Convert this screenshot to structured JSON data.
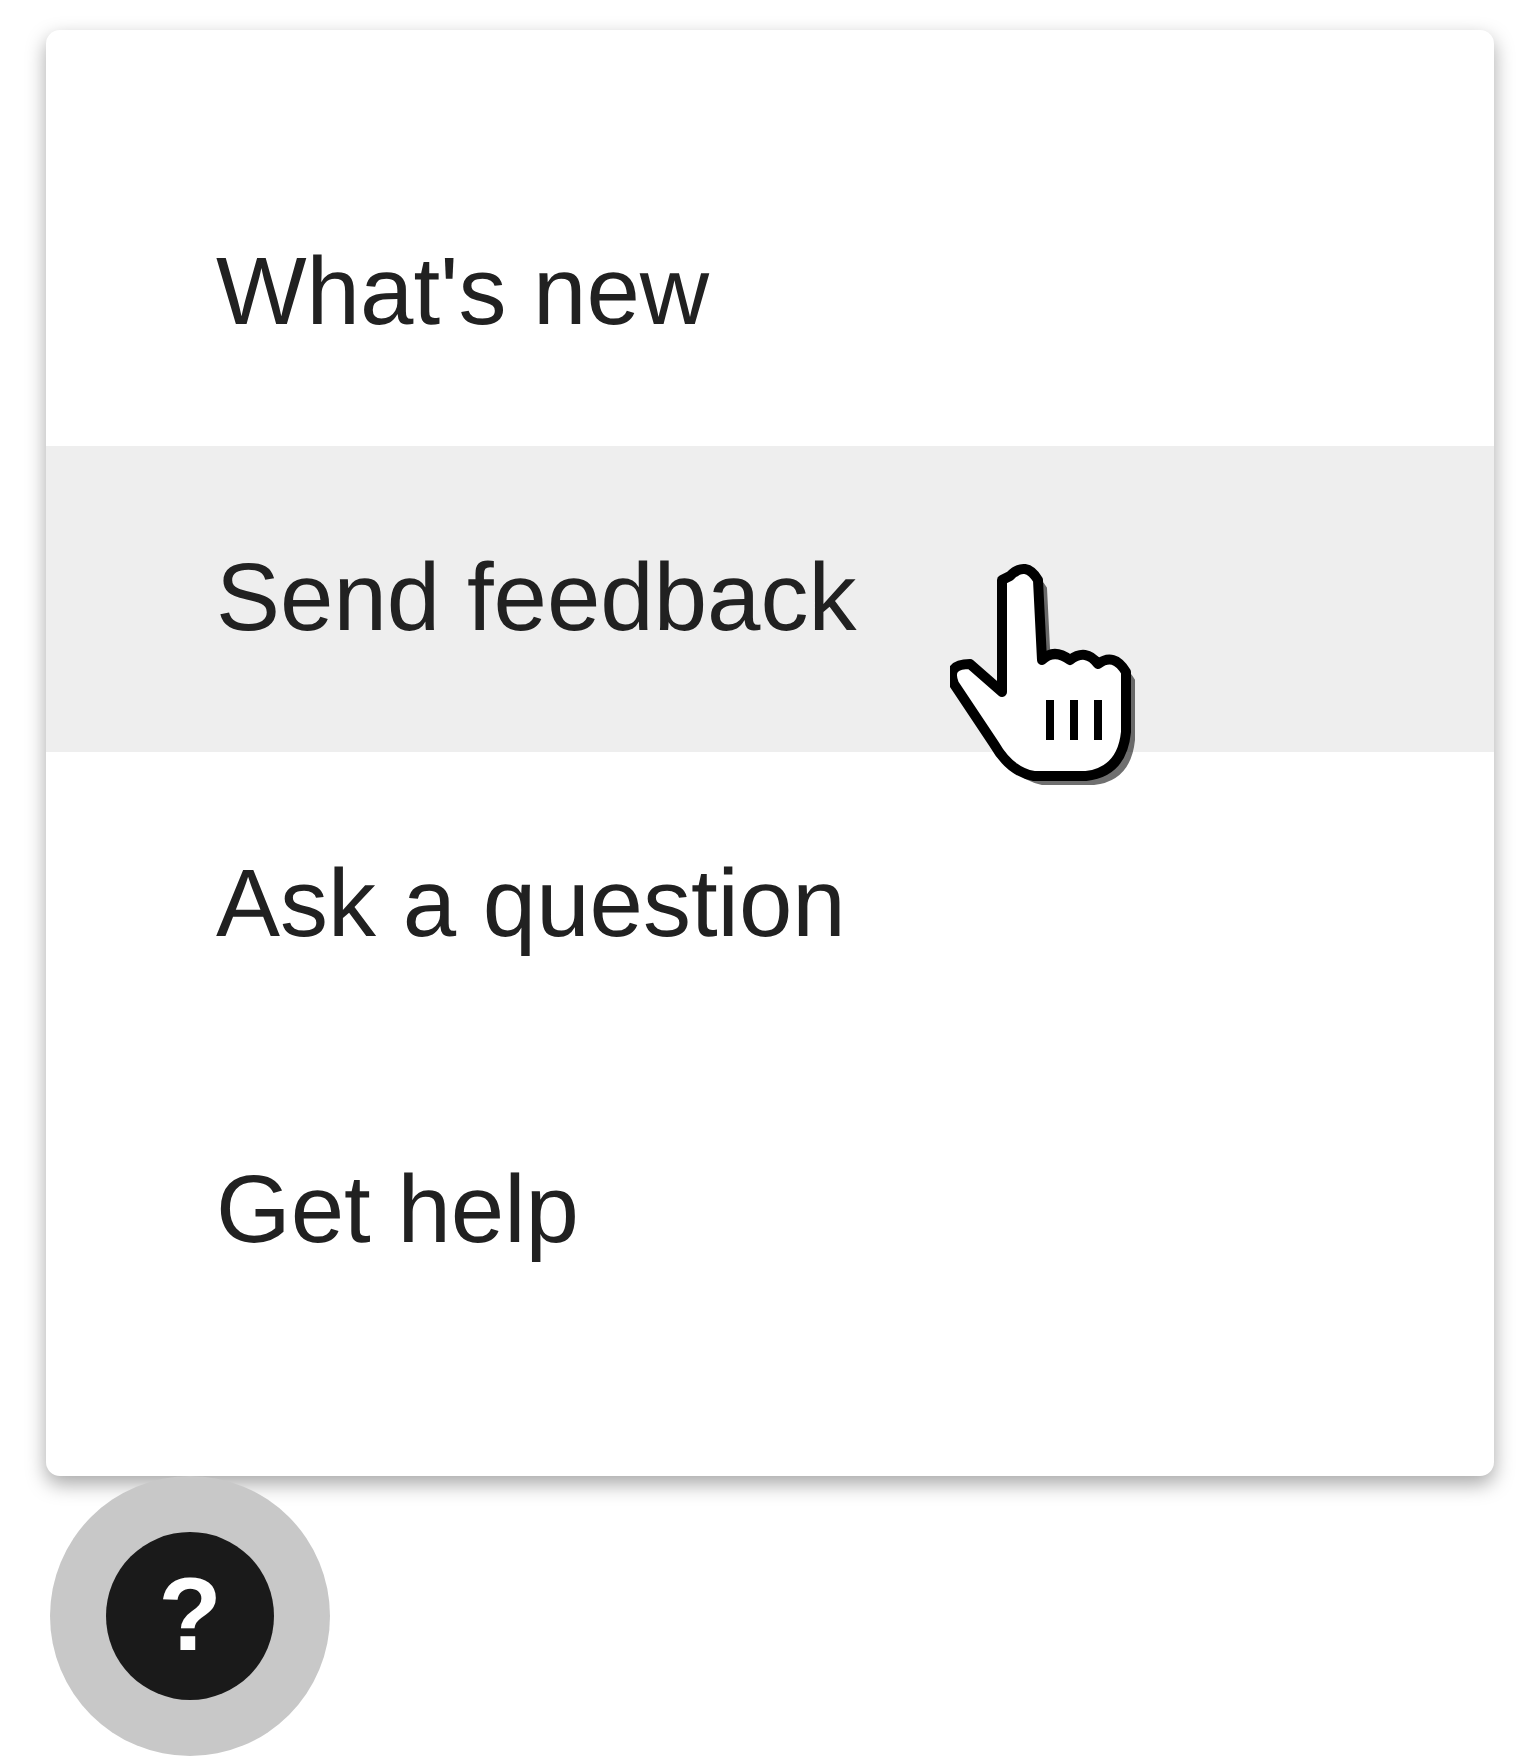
{
  "menu": {
    "items": [
      {
        "label": "What's new",
        "hovered": false
      },
      {
        "label": "Send feedback",
        "hovered": true
      },
      {
        "label": "Ask a question",
        "hovered": false
      },
      {
        "label": "Get help",
        "hovered": false
      }
    ]
  },
  "help_button": {
    "symbol": "?"
  }
}
